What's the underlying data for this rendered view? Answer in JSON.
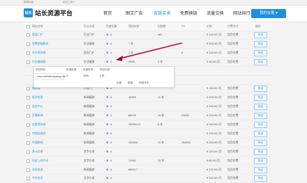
{
  "topbar": {
    "left": "新闻动态",
    "middle": "站长工具 ▾"
  },
  "logo": {
    "mark": "站长",
    "text": "站长资源平台"
  },
  "nav": [
    "首页",
    "图文广告",
    "友链买卖",
    "免费换链",
    "流量交换",
    "网站排行"
  ],
  "nav_active": 2,
  "cta": "我的交易 ▾",
  "headers": [
    "网站名称",
    "行业分类",
    "百度权重",
    "网站年龄",
    "出链数",
    "PR",
    "价格",
    "付费方式",
    "操作"
  ],
  "rows": [
    {
      "name": "家居门户",
      "cat": "行业门户",
      "bw": "4",
      "age": "",
      "out": "480",
      "pr": "",
      "price": "¥ 100.00 /月",
      "pay": "包月付费",
      "btn": "购买"
    },
    {
      "name": "免费综链服务",
      "cat": "生活服务",
      "bw": "4",
      "age": "7 年",
      "out": "",
      "pr": "5",
      "price": "¥ 300.00 /月",
      "pay": "包月付费",
      "btn": "购买"
    },
    {
      "name": "东方资讯网",
      "cat": "资讯门户",
      "bw": "4",
      "age": "1 年",
      "out": "",
      "pr": "5",
      "price": "¥ 100.00 /月",
      "pay": "包月付费",
      "btn": "购买"
    },
    {
      "name": "兴永基站网",
      "cat": "生活服务",
      "bw": "4",
      "age": "2955",
      "out": "4 年",
      "pr": "",
      "price": "¥ 90.00 /月",
      "pay": "包月付费",
      "btn": "购买"
    },
    {
      "name": "",
      "cat": "",
      "bw": "",
      "age": "",
      "out": "",
      "pr": "",
      "price": "",
      "pay": "",
      "btn": ""
    },
    {
      "name": "",
      "cat": "",
      "bw": "",
      "age": "",
      "out": "",
      "pr": "",
      "price": "",
      "pay": "",
      "btn": ""
    },
    {
      "name": "服务类",
      "cat": "行业门",
      "bw": "4",
      "age": "",
      "out": "",
      "pr": "",
      "price": "¥ 100.00 /月",
      "pay": "包月付费",
      "btn": "购买"
    },
    {
      "name": "经济信息",
      "cat": "新闻媒体",
      "bw": "4",
      "age": "42855",
      "out": "11 年",
      "pr": "",
      "price": "¥ 300.00 /月",
      "pay": "包月付费",
      "btn": "购买"
    },
    {
      "name": "优化中心",
      "cat": "新闻媒体",
      "bw": "4",
      "age": "",
      "out": "",
      "pr": "",
      "price": "¥ 100.00 /月",
      "pay": "包月付费",
      "btn": "购买"
    },
    {
      "name": "百事新闻",
      "cat": "新闻媒体",
      "bw": "4",
      "age": "86075",
      "out": "19 年",
      "pr": "23800",
      "price": "¥ 200.00 /月",
      "pay": "包月付费",
      "btn": "购买"
    },
    {
      "name": "信息资讯网",
      "cat": "新闻媒体",
      "bw": "4",
      "age": "11638474",
      "out": "6 年",
      "pr": "",
      "price": "¥ 160.00 /月",
      "pay": "包月付费",
      "btn": "购买"
    },
    {
      "name": "中国信息网",
      "cat": "新闻媒体",
      "bw": "4",
      "age": "",
      "out": "",
      "pr": "",
      "price": "¥ 100.00 /月",
      "pay": "包月付费",
      "btn": "购买"
    },
    {
      "name": "中国新闻",
      "cat": "新闻媒体",
      "bw": "4",
      "age": "292554",
      "out": "11 年",
      "pr": "194000",
      "price": "¥ 200.00 /月",
      "pay": "包月付费",
      "btn": "购买"
    },
    {
      "name": "多元交易",
      "cat": "文字小说",
      "bw": "4",
      "age": "",
      "out": "",
      "pr": "",
      "price": "¥ 100.00 /月",
      "pay": "包月付费",
      "btn": "购买"
    },
    {
      "name": "历史上的今天",
      "cat": "文字小说",
      "bw": "4",
      "age": "72662",
      "out": "12 年",
      "pr": "",
      "price": "¥ 80.00 /月",
      "pay": "包月付费",
      "btn": "购买"
    },
    {
      "name": "文化交流",
      "cat": "新闻媒体",
      "bw": "4",
      "age": "860017",
      "out": "",
      "pr": "",
      "price": "¥ 100.00 /月",
      "pay": "包月付费",
      "btn": "购买"
    },
    {
      "name": "中华名言",
      "cat": "文字小说",
      "bw": "4",
      "age": "",
      "out": "",
      "pr": "",
      "price": "¥ 100.00 /月",
      "pay": "包月付费",
      "btn": "购买"
    }
  ],
  "popup": {
    "url_label": "网站网址",
    "rank_label": "百度权重",
    "rank2_label": "百度收录",
    "age_label": "网站年龄",
    "out_label": "出链",
    "price_label": "数据",
    "pr_label": "网络排名",
    "url": "www.weihaihuiquang.com",
    "rank": "4",
    "rank2": "2955",
    "age": "4 年"
  }
}
